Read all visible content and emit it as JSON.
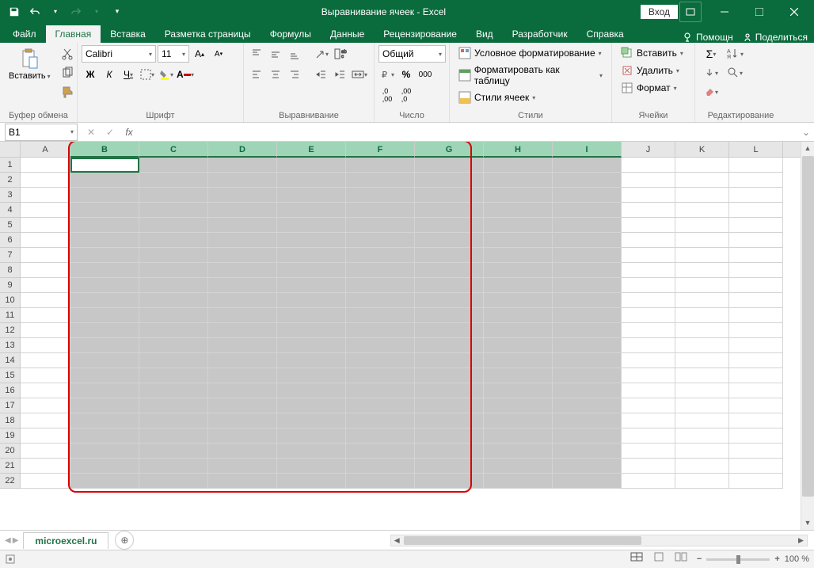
{
  "title": "Выравнивание ячеек  -  Excel",
  "signin": "Вход",
  "tabs": {
    "file": "Файл",
    "home": "Главная",
    "insert": "Вставка",
    "pagelayout": "Разметка страницы",
    "formulas": "Формулы",
    "data": "Данные",
    "review": "Рецензирование",
    "view": "Вид",
    "developer": "Разработчик",
    "help": "Справка",
    "tellme": "Помощн",
    "share": "Поделиться"
  },
  "groups": {
    "clipboard": "Буфер обмена",
    "font": "Шрифт",
    "alignment": "Выравнивание",
    "number": "Число",
    "styles": "Стили",
    "cells": "Ячейки",
    "editing": "Редактирование"
  },
  "ribbon": {
    "paste": "Вставить",
    "font_name": "Calibri",
    "font_size": "11",
    "number_format": "Общий",
    "cond_format": "Условное форматирование",
    "format_table": "Форматировать как таблицу",
    "cell_styles": "Стили ячеек",
    "insert": "Вставить",
    "delete": "Удалить",
    "format": "Формат"
  },
  "name_box": "B1",
  "columns": [
    "A",
    "B",
    "C",
    "D",
    "E",
    "F",
    "G",
    "H",
    "I",
    "J",
    "K",
    "L"
  ],
  "selected_cols": [
    "B",
    "C",
    "D",
    "E",
    "F",
    "G",
    "H",
    "I"
  ],
  "rows": [
    1,
    2,
    3,
    4,
    5,
    6,
    7,
    8,
    9,
    10,
    11,
    12,
    13,
    14,
    15,
    16,
    17,
    18,
    19,
    20,
    21,
    22
  ],
  "sheet_tab": "microexcel.ru",
  "zoom": "100 %"
}
